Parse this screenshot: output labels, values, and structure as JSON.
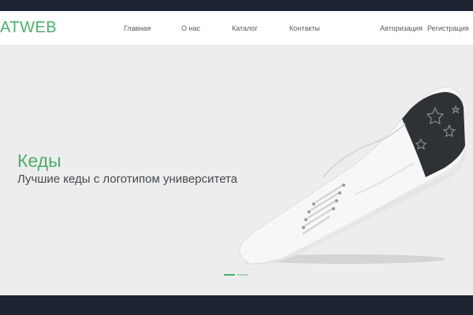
{
  "header": {
    "logo": "ATWEB",
    "nav": {
      "home": "Главная",
      "about": "О нас",
      "catalog": "Каталог",
      "contacts": "Контакты"
    },
    "auth": {
      "login": "Авторизация",
      "register": "Регистрация"
    }
  },
  "hero": {
    "title": "Кеды",
    "subtitle": "Лучшие кеды с логотипом университета",
    "image": "sneaker-photo",
    "active_slide": 1,
    "slide_count": 2
  },
  "colors": {
    "brand": "#4caf6e",
    "dark_bar": "#1c2331",
    "hero_bg": "#ededed"
  }
}
